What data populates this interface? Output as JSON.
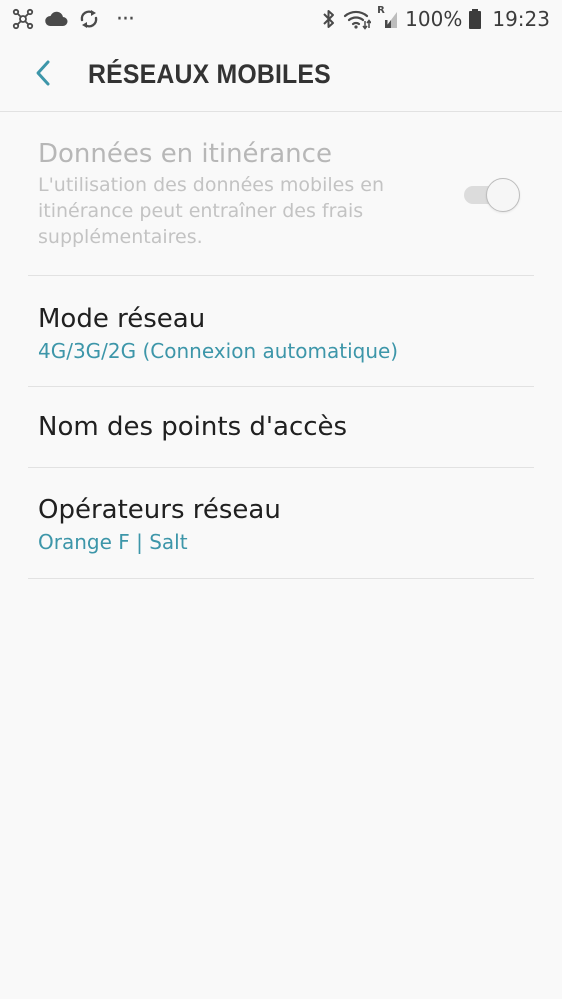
{
  "status_bar": {
    "left_icons": [
      "network-hub-icon",
      "cloud-icon",
      "sync-arrows-icon",
      "more-dots-icon"
    ],
    "right_icons": [
      "bluetooth-icon",
      "wifi-icon",
      "signal-roaming-icon",
      "battery-icon"
    ],
    "roaming_letter": "R",
    "battery": "100%",
    "time": "19:23",
    "more_dots": "···"
  },
  "header": {
    "title": "RÉSEAUX MOBILES",
    "back_icon": "chevron-left-icon",
    "accent_color": "#3d96a9"
  },
  "settings": {
    "roaming": {
      "title": "Données en itinérance",
      "description": "L'utilisation des données mobiles en itinérance peut entraîner des frais supplémentaires.",
      "toggle_state": "off-disabled"
    },
    "network_mode": {
      "title": "Mode réseau",
      "value": "4G/3G/2G (Connexion automatique)"
    },
    "apn": {
      "title": "Nom des points d'accès"
    },
    "operators": {
      "title": "Opérateurs réseau",
      "value": "Orange F | Salt"
    }
  },
  "colors": {
    "background": "#f9f9f9",
    "divider": "#e2e2e2",
    "value_text": "#3d96a9",
    "disabled_text": "#b7b7b7"
  }
}
